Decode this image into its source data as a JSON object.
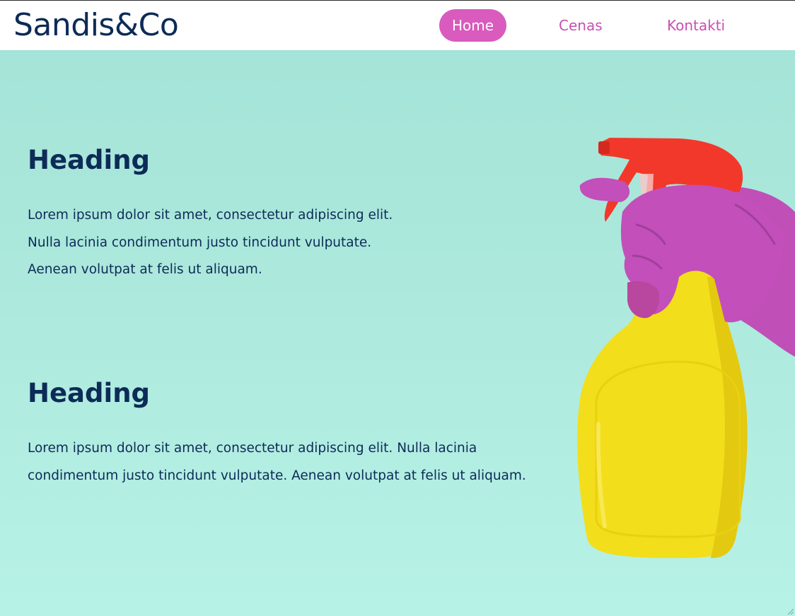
{
  "brand": {
    "name": "Sandis&Co"
  },
  "nav": {
    "items": [
      {
        "label": "Home",
        "active": true
      },
      {
        "label": "Cenas",
        "active": false
      },
      {
        "label": "Kontakti",
        "active": false
      }
    ]
  },
  "sections": [
    {
      "heading": "Heading",
      "lines": [
        "Lorem ipsum dolor sit amet, consectetur adipiscing elit.",
        "Nulla lacinia condimentum justo tincidunt vulputate.",
        "Aenean volutpat at felis ut aliquam."
      ]
    },
    {
      "heading": "Heading",
      "lines": [
        "Lorem ipsum dolor sit amet, consectetur adipiscing elit. Nulla lacinia",
        "condimentum justo tincidunt vulputate. Aenean volutpat at felis ut aliquam."
      ]
    }
  ],
  "colors": {
    "brand_navy": "#0d2b57",
    "accent_pink": "#d95bbd",
    "background_mint": "#ade9dd",
    "bottle_yellow": "#f2df1e",
    "trigger_red": "#f2382a",
    "glove_purple": "#c14fb8"
  },
  "hero_image": {
    "icon": "spray-bottle-glove-illustration"
  }
}
